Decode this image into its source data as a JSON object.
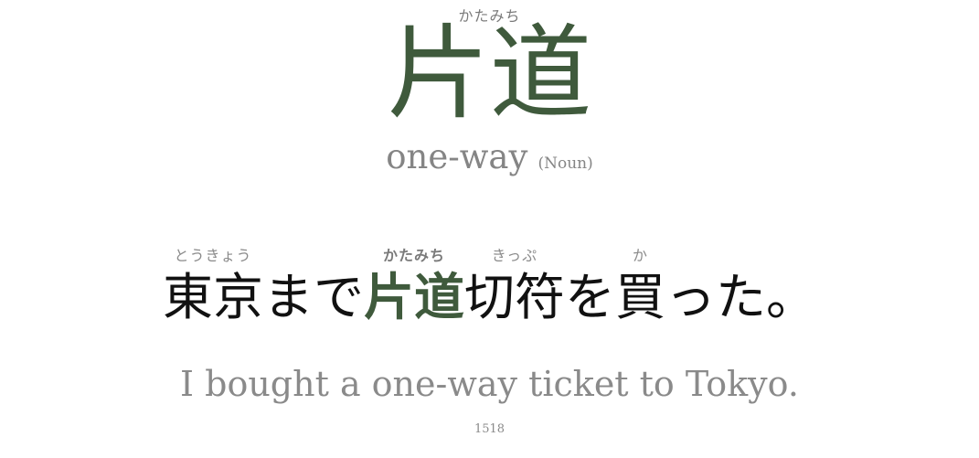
{
  "word": {
    "reading": "かたみち",
    "kanji": "片道",
    "meaning": "one-way",
    "part_of_speech": "(Noun)"
  },
  "sentence": {
    "segments": [
      {
        "text": "東京",
        "furigana": "とうきょう"
      },
      {
        "text": "まで",
        "furigana": ""
      },
      {
        "text": "片道",
        "furigana": "かたみち",
        "target": true
      },
      {
        "text": "切符",
        "furigana": "きっぷ"
      },
      {
        "text": "を",
        "furigana": ""
      },
      {
        "text": "買",
        "furigana": "か"
      },
      {
        "text": "った。",
        "furigana": ""
      }
    ],
    "translation": "I bought a one-way ticket to Tokyo."
  },
  "card": {
    "id": "1518"
  },
  "colors": {
    "accent": "#3f5a3c",
    "muted": "#858585",
    "text": "#111111",
    "background": "#ffffff"
  }
}
